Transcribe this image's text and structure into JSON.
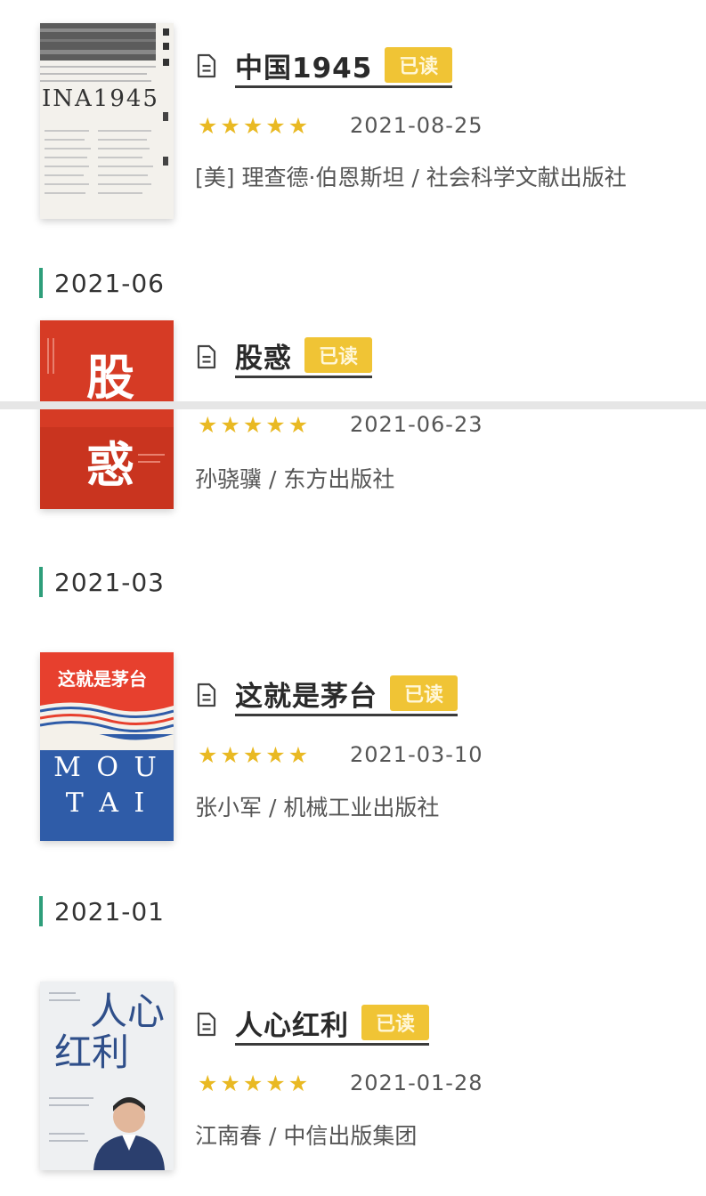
{
  "books": [
    {
      "title": "中国1945",
      "badge": "已读",
      "rating": 5,
      "date": "2021-08-25",
      "meta": "[美] 理查德·伯恩斯坦 / 社会科学文献出版社",
      "cover_text": "INA1945"
    },
    {
      "title": "股惑",
      "badge": "已读",
      "rating": 5,
      "date": "2021-06-23",
      "meta": "孙骁骥 / 东方出版社",
      "cover_text_top": "股",
      "cover_text_bottom": "惑"
    },
    {
      "title": "这就是茅台",
      "badge": "已读",
      "rating": 5,
      "date": "2021-03-10",
      "meta": "张小军 / 机械工业出版社",
      "cover_title": "这就是茅台",
      "cover_line1": "M O U",
      "cover_line2": "T A I"
    },
    {
      "title": "人心红利",
      "badge": "已读",
      "rating": 5,
      "date": "2021-01-28",
      "meta": "江南春 / 中信出版集团",
      "cover_line1": "人心",
      "cover_line2": "红利"
    }
  ],
  "sections": [
    "2021-06",
    "2021-03",
    "2021-01"
  ],
  "colors": {
    "accent_bar": "#2e9e7a",
    "badge": "#f0c435",
    "star": "#e9b923"
  },
  "icons": {
    "title_icon": "document-icon",
    "rating_icon": "star-icon"
  }
}
